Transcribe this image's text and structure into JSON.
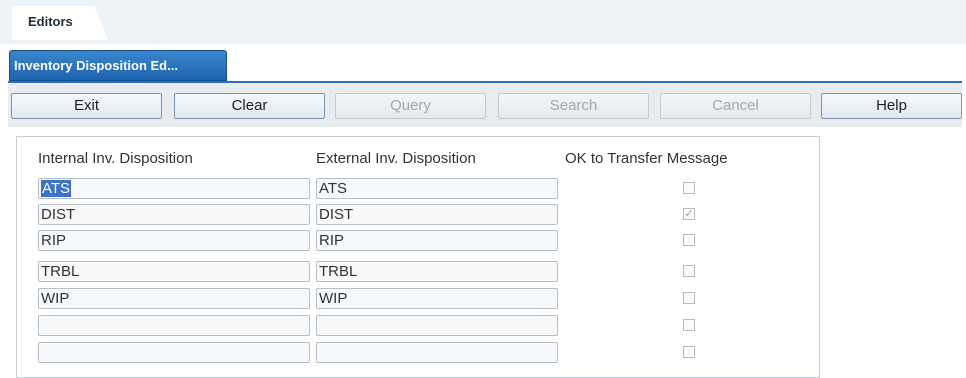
{
  "top_tab": {
    "label": "Editors"
  },
  "doc_tab": {
    "label": "Inventory Disposition Ed..."
  },
  "toolbar": {
    "exit": "Exit",
    "clear": "Clear",
    "query": "Query",
    "search": "Search",
    "cancel": "Cancel",
    "help": "Help"
  },
  "table": {
    "headers": [
      "Internal Inv. Disposition",
      "External Inv. Disposition",
      "OK to Transfer Message"
    ],
    "rows": [
      {
        "internal": "ATS",
        "external": "ATS",
        "ok_to_transfer": false
      },
      {
        "internal": "DIST",
        "external": "DIST",
        "ok_to_transfer": true
      },
      {
        "internal": "RIP",
        "external": "RIP",
        "ok_to_transfer": false
      },
      {
        "internal": "TRBL",
        "external": "TRBL",
        "ok_to_transfer": false
      },
      {
        "internal": "WIP",
        "external": "WIP",
        "ok_to_transfer": false
      },
      {
        "internal": "",
        "external": "",
        "ok_to_transfer": false
      },
      {
        "internal": "",
        "external": "",
        "ok_to_transfer": false
      }
    ]
  },
  "colors": {
    "accent": "#1f63ae",
    "selection": "#3b73c9"
  }
}
